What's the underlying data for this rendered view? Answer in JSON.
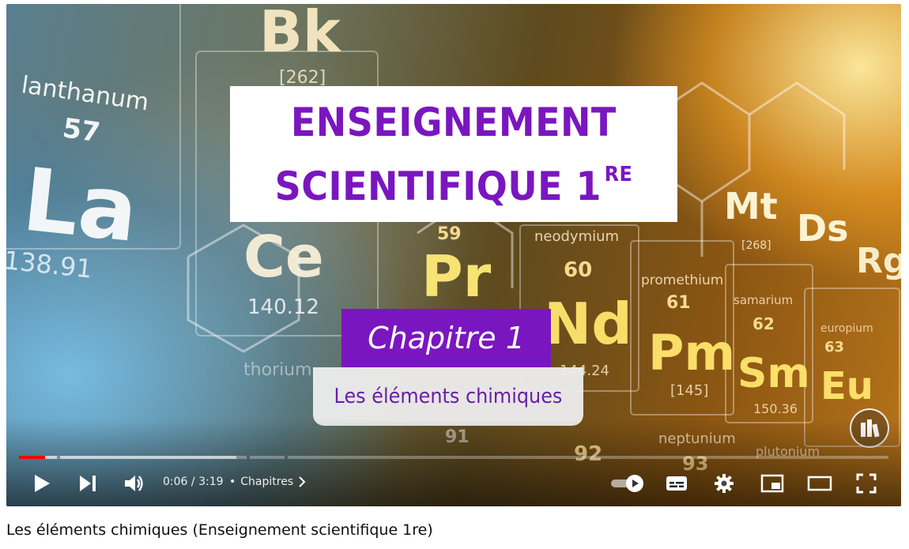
{
  "video": {
    "title_line1": "ENSEIGNEMENT",
    "title_line2": "SCIENTIFIQUE 1",
    "title_sup": "RE",
    "chapter": "Chapitre 1",
    "subtitle": "Les éléments chimiques",
    "accent_color": "#7a16bf",
    "background_text": {
      "bk": "Bk",
      "bk_mass": "[262]",
      "lanthanum": "lanthanum",
      "la_number": "57",
      "la": "La",
      "la_mass": "138.91",
      "ce": "Ce",
      "ce_mass": "140.12",
      "pr_number": "59",
      "pr": "Pr",
      "neodymium": "neodymium",
      "nd_number": "60",
      "nd": "Nd",
      "nd_mass": "144.24",
      "promethium": "promethium",
      "pm_number": "61",
      "pm": "Pm",
      "pm_mass": "[145]",
      "samarium": "samarium",
      "sm_number": "62",
      "sm": "Sm",
      "sm_mass": "150.36",
      "europium": "europium",
      "eu_number": "63",
      "eu": "Eu",
      "mt": "Mt",
      "mt_mass": "[268]",
      "ds": "Ds",
      "rg": "Rg",
      "thorium": "thorium",
      "neptunium": "neptunium",
      "np_number": "93",
      "plutonium": "plutonium",
      "u_number": "92",
      "pa_number": "91"
    }
  },
  "player": {
    "current_time": "0:06",
    "separator": "/",
    "duration": "3:19",
    "bullet": "•",
    "chapters_label": "Chapitres",
    "progress_played_fraction": 0.03,
    "progress_buffered_fraction": 0.25,
    "progress_color": "#ff0000",
    "autoplay_on": true
  },
  "page": {
    "video_title": "Les éléments chimiques (Enseignement scientifique 1re)"
  }
}
